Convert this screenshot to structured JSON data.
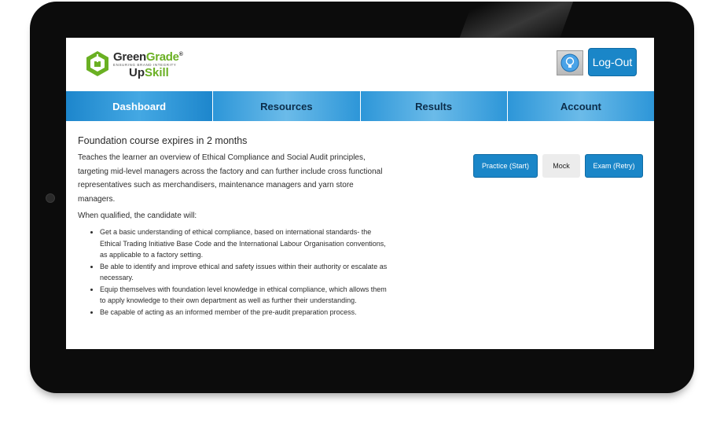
{
  "header": {
    "logo": {
      "name_part1": "Green",
      "name_part2": "Grade",
      "registered": "®",
      "tagline": "ENSURING BRAND INTEGRITY",
      "sub_part1": "Up",
      "sub_part2": "Skill"
    },
    "help_icon": "lightbulb-icon",
    "logout_label": "Log-Out"
  },
  "nav": {
    "items": [
      {
        "label": "Dashboard",
        "active": true
      },
      {
        "label": "Resources",
        "active": false
      },
      {
        "label": "Results",
        "active": false
      },
      {
        "label": "Account",
        "active": false
      }
    ]
  },
  "main": {
    "expires_text": "Foundation course expires in 2 months",
    "intro": "Teaches the learner an overview of Ethical Compliance and Social Audit principles, targeting mid-level managers across the factory and can further include cross functional representatives such as merchandisers, maintenance managers and yarn store managers.",
    "qualified_text": "When qualified, the candidate will:",
    "bullets": [
      "Get a basic understanding of ethical compliance, based on international standards- the Ethical Trading Initiative Base Code and the International Labour Organisation conventions, as applicable to a factory setting.",
      "Be able to identify and improve ethical and safety issues within their authority or escalate as necessary.",
      "Equip themselves with foundation level knowledge in ethical compliance, which allows them to apply knowledge to their own department as well as further their understanding.",
      "Be capable of acting as an informed member of the pre-audit preparation process."
    ],
    "actions": {
      "practice_label": "Practice (Start)",
      "mock_label": "Mock",
      "exam_label": "Exam (Retry)"
    }
  },
  "colors": {
    "brand_green": "#6ab023",
    "primary_blue": "#1a86c8",
    "nav_blue": "#2d96d8"
  }
}
